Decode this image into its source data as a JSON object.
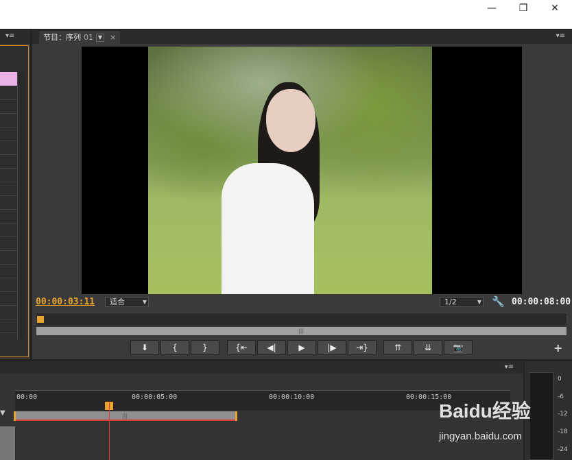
{
  "window": {
    "minimize_glyph": "—",
    "maximize_glyph": "❐",
    "close_glyph": "✕"
  },
  "monitor": {
    "tab_label": "节目：序列",
    "tab_number": "01",
    "current_time": "00:00:03:11",
    "total_time": "00:00:08:00",
    "fit_select": "适合",
    "resolution_select": "1/2"
  },
  "controls": [
    {
      "name": "add-marker-button",
      "glyph": "⬇"
    },
    {
      "name": "mark-in-button",
      "glyph": "{"
    },
    {
      "name": "mark-out-button",
      "glyph": "}"
    },
    {
      "name": "go-to-in-button",
      "glyph": "{⇤"
    },
    {
      "name": "step-back-button",
      "glyph": "◀|"
    },
    {
      "name": "play-button",
      "glyph": "▶"
    },
    {
      "name": "step-forward-button",
      "glyph": "|▶"
    },
    {
      "name": "go-to-out-button",
      "glyph": "⇥}"
    },
    {
      "name": "lift-button",
      "glyph": "⇈"
    },
    {
      "name": "extract-button",
      "glyph": "⇊"
    },
    {
      "name": "export-frame-button",
      "glyph": "📷"
    }
  ],
  "timeline": {
    "ruler_labels": [
      "00:00",
      "00:00:05:00",
      "00:00:10:00",
      "00:00:15:00"
    ]
  },
  "meter": {
    "labels": [
      "0",
      "-6",
      "-12",
      "-18",
      "-24"
    ]
  },
  "watermark": {
    "brand": "Baidu经验",
    "url": "jingyan.baidu.com"
  },
  "colors": {
    "accent_orange": "#e8a230",
    "panel_dark": "#2b2b2b",
    "panel": "#3a3a3a",
    "playhead_red": "#e03a3a"
  }
}
